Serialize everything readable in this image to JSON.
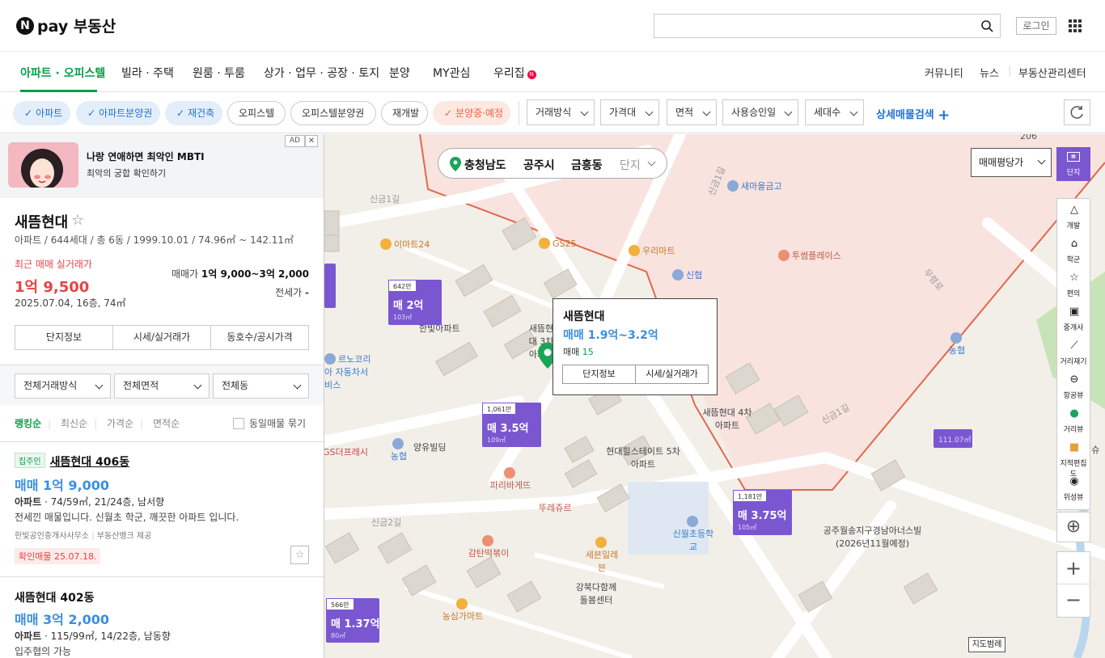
{
  "header": {
    "logo_text": "pay 부동산",
    "logo_badge": "N",
    "login": "로그인"
  },
  "nav": {
    "items": [
      "아파트 · 오피스텔",
      "빌라 · 주택",
      "원룸 · 투룸",
      "상가 · 업무 · 공장 · 토지",
      "분양",
      "MY관심",
      "우리집"
    ],
    "right": [
      "커뮤니티",
      "뉴스",
      "부동산관리센터"
    ]
  },
  "filters": {
    "chips": [
      "아파트",
      "아파트분양권",
      "재건축",
      "오피스텔",
      "오피스텔분양권",
      "재개발",
      "분양중·예정"
    ],
    "dropdowns": [
      "거래방식",
      "가격대",
      "면적",
      "사용승인일",
      "세대수"
    ],
    "detail": "상세매물검색"
  },
  "ad": {
    "label": "AD",
    "close": "✕",
    "title": "나랑 연애하면 최악인 MBTI",
    "sub": "최악의 궁합 확인하기"
  },
  "complex": {
    "name": "새뜸현대",
    "info": "아파트 / 644세대 / 총 6동 / 1999.10.01 / 74.96㎡ ~ 142.11㎡",
    "recent_label": "최근 매매 실거래가",
    "recent_price": "1억 9,500",
    "recent_date": "2025.07.04, 16층, 74㎡",
    "sale_label": "매매가",
    "sale_range": "1억 9,000~3억 2,000",
    "jeonse_label": "전세가",
    "jeonse_value": "-",
    "buttons": [
      "단지정보",
      "시세/실거래가",
      "동호수/공시가격"
    ]
  },
  "list_filters": [
    "전체거래방식",
    "전체면적",
    "전체동"
  ],
  "sorts": [
    "랭킹순",
    "최신순",
    "가격순",
    "면적순"
  ],
  "same_toggle": "동일매물 묶기",
  "listings": [
    {
      "tag": "집주인",
      "title": "새뜸현대 406동",
      "price": "매매 1억 9,000",
      "type": "아파트",
      "meta": "74/59㎡, 21/24층, 남서향",
      "desc": "전세낀 매물입니다. 신월초 학군, 깨끗한 아파트 입니다.",
      "agent": "한빛공인중개사사무소",
      "provider": "부동산뱅크 제공",
      "confirm": "확인매물 25.07.18."
    },
    {
      "title": "새뜸현대 402동",
      "price": "매매 3억 2,000",
      "type": "아파트",
      "meta": "115/99㎡, 14/22층, 남동향",
      "desc": "입주협의 가능"
    }
  ],
  "map": {
    "location": [
      "충청남도",
      "공주시",
      "금흥동",
      "단지"
    ],
    "price_select": "매매평당가",
    "danji_label": "단지",
    "tools": [
      "개발",
      "학군",
      "편의",
      "중개사",
      "거리재기",
      "항공뷰",
      "거리뷰",
      "지적편집도",
      "위성뷰"
    ],
    "scale": "지도범례",
    "popup": {
      "title": "새뜸현대",
      "price": "매매 1.9억~3.2억",
      "count_label": "매매",
      "count": "15",
      "buttons": [
        "단지정보",
        "시세/실거래가"
      ]
    },
    "markers": [
      {
        "count": "642만",
        "price": "매 2억",
        "area": "103㎡"
      },
      {
        "count": "1,061만",
        "price": "매 3.5억",
        "area": "109㎡"
      },
      {
        "count": "1,181만",
        "price": "매 3.75억",
        "area": "105㎡"
      },
      {
        "count": "566만",
        "price": "매 1.37억",
        "area": "80㎡"
      },
      {
        "area": "111.07㎡"
      }
    ],
    "labels": [
      "이마트24",
      "GS25",
      "우리마트",
      "신협",
      "새마을금고",
      "투썸플레이스",
      "새뜸현대 3차아파트",
      "한빛아파트",
      "현대힐스테이트 5차아파트",
      "새뜸현대 4차아파트",
      "양유빌딩",
      "농협",
      "파리바게뜨",
      "뚜레쥬르",
      "세븐일레븐",
      "감탄떡볶이",
      "신월초등학교",
      "농심가마트",
      "강북다함께 돌봄센터",
      "공주월송지구경남아너스빌 (2026년11월예정)",
      "신금1길",
      "신금2길",
      "무령로",
      "GS더프레시",
      "르노코리아 자동차서비스",
      "삼미슈퍼",
      "신금1길"
    ]
  }
}
